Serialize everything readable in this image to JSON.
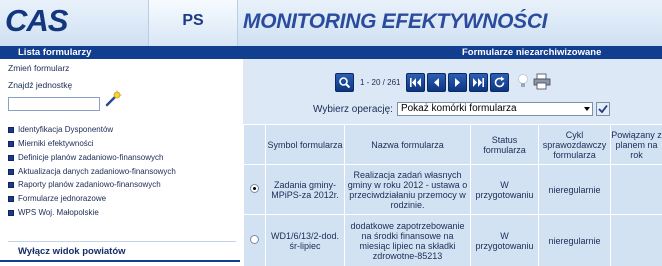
{
  "header": {
    "logo": "CAS",
    "module": "PS",
    "title": "MONITORING EFEKTYWNOŚCI"
  },
  "bar": {
    "left": "Lista formularzy",
    "right": "Formularze niezarchiwizowane"
  },
  "sidebar": {
    "change_form": "Zmień formularz",
    "find_unit": "Znajdź jednostkę",
    "search_value": "",
    "items": [
      "Identyfikacja Dysponentów",
      "Mierniki efektywności",
      "Definicje planów zadaniowo-finansowych",
      "Aktualizacja danych zadaniowo-finansowych",
      "Raporty planów zadaniowo-finansowych",
      "Formularze jednorazowe",
      "WPS Woj. Małopolskie"
    ],
    "toggle_districts": "Wyłącz widok powiatów"
  },
  "pager": {
    "range": "1 - 20 / 261"
  },
  "operation": {
    "label": "Wybierz operację:",
    "selected": "Pokaż komórki formularza"
  },
  "table": {
    "columns": [
      "",
      "Symbol formularza",
      "Nazwa formularza",
      "Status formularza",
      "Cykl sprawozdawczy formularza",
      "Powiązany z planem na rok"
    ],
    "rows": [
      {
        "selected": true,
        "symbol": "Zadania gminy-MPiPS-za 2012r.",
        "name": "Realizacja zadań własnych gminy w roku 2012 - ustawa o przeciwdziałaniu przemocy w rodzinie.",
        "status": "W przygotowaniu",
        "cycle": "nieregularnie",
        "plan_year": ""
      },
      {
        "selected": false,
        "symbol": "WD1/6/13/2-dod. śr-lipiec",
        "name": "dodatkowe zapotrzebowanie na środki finansowe na miesiąc lipiec na składki zdrowotne-85213",
        "status": "W przygotowaniu",
        "cycle": "nieregularnie",
        "plan_year": ""
      }
    ]
  },
  "colors": {
    "navy": "#123e8f",
    "panel": "#dce8f5",
    "cell": "#d3e2f3"
  }
}
